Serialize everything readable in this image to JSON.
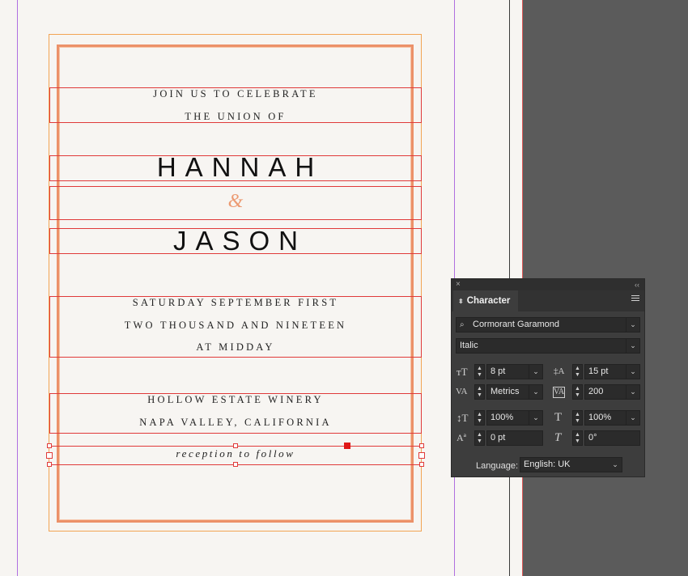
{
  "invitation": {
    "line1": "JOIN US TO CELEBRATE",
    "line2": "THE UNION OF",
    "name1": "HANNAH",
    "ampersand": "&",
    "name2": "JASON",
    "date1": "SATURDAY SEPTEMBER FIRST",
    "date2": "TWO THOUSAND AND NINETEEN",
    "date3": "AT MIDDAY",
    "venue1": "HOLLOW ESTATE WINERY",
    "venue2": "NAPA VALLEY, CALIFORNIA",
    "reception": "reception to follow"
  },
  "panel": {
    "close": "×",
    "collapse": "‹‹",
    "tab_label": "Character",
    "font_family": "Cormorant Garamond",
    "font_style": "Italic",
    "font_size": "8 pt",
    "leading": "15 pt",
    "kerning": "Metrics",
    "tracking": "200",
    "vertical_scale": "100%",
    "horizontal_scale": "100%",
    "baseline_shift": "0 pt",
    "skew": "0°",
    "language_label": "Language:",
    "language": "English: UK"
  },
  "colors": {
    "frame": "#e03a3a",
    "border_outer": "#f2a453",
    "border_inner": "#ec9169",
    "ampersand": "#ec9a72",
    "panel_bg": "#3d3d3d",
    "dark_pasteboard": "#5b5b5b"
  }
}
